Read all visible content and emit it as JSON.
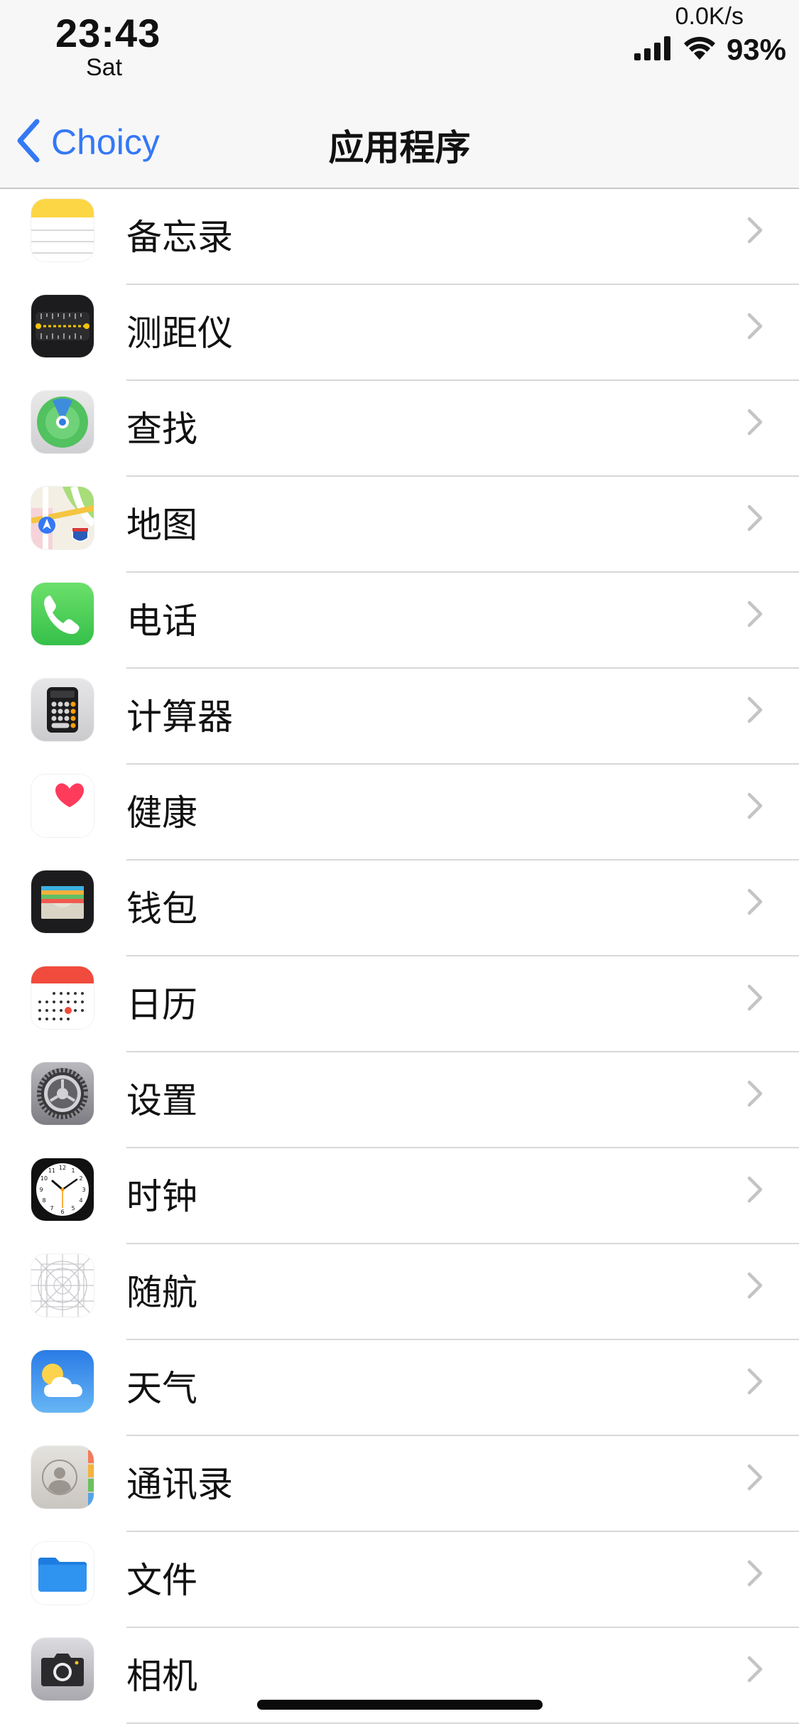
{
  "status_bar": {
    "time": "23:43",
    "day": "Sat",
    "network_speed": "0.0K/s",
    "battery": "93%"
  },
  "nav": {
    "back_label": "Choicy",
    "title": "应用程序"
  },
  "apps": [
    {
      "label": "备忘录",
      "icon": "notes-icon"
    },
    {
      "label": "测距仪",
      "icon": "measure-icon"
    },
    {
      "label": "查找",
      "icon": "find-my-icon"
    },
    {
      "label": "地图",
      "icon": "maps-icon"
    },
    {
      "label": "电话",
      "icon": "phone-icon"
    },
    {
      "label": "计算器",
      "icon": "calculator-icon"
    },
    {
      "label": "健康",
      "icon": "health-icon"
    },
    {
      "label": "钱包",
      "icon": "wallet-icon"
    },
    {
      "label": "日历",
      "icon": "calendar-icon"
    },
    {
      "label": "设置",
      "icon": "settings-icon"
    },
    {
      "label": "时钟",
      "icon": "clock-icon"
    },
    {
      "label": "随航",
      "icon": "sidecar-icon"
    },
    {
      "label": "天气",
      "icon": "weather-icon"
    },
    {
      "label": "通讯录",
      "icon": "contacts-icon"
    },
    {
      "label": "文件",
      "icon": "files-icon"
    },
    {
      "label": "相机",
      "icon": "camera-icon"
    }
  ],
  "colors": {
    "accent": "#3478f6",
    "bar_background": "#f7f7f7"
  }
}
